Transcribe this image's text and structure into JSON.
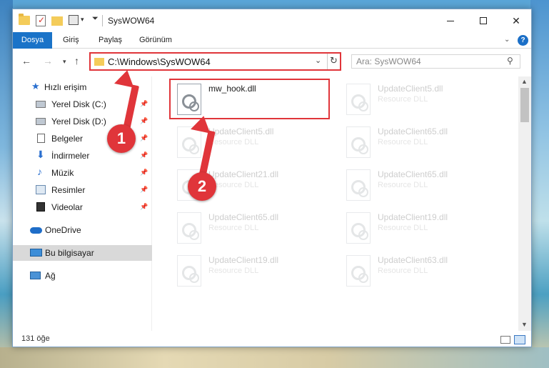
{
  "window": {
    "title": "SysWOW64",
    "minimize_label": "—",
    "close_label": "✕"
  },
  "ribbon": {
    "tabs": [
      "Dosya",
      "Giriş",
      "Paylaş",
      "Görünüm"
    ],
    "help_label": "?"
  },
  "address_bar": {
    "path": "C:\\Windows\\SysWOW64",
    "search_placeholder": "Ara: SysWOW64"
  },
  "nav_pane": {
    "quick_access": "Hızlı erişim",
    "pinned": [
      {
        "label": "Yerel Disk (C:)"
      },
      {
        "label": "Yerel Disk (D:)"
      },
      {
        "label": "Belgeler"
      },
      {
        "label": "İndirmeler"
      },
      {
        "label": "Müzik"
      },
      {
        "label": "Resimler"
      },
      {
        "label": "Videolar"
      }
    ],
    "onedrive": "OneDrive",
    "this_pc": "Bu bilgisayar",
    "network": "Ağ"
  },
  "files": [
    {
      "name": "mw_hook.dll",
      "desc": "",
      "highlighted": true
    },
    {
      "name": "UpdateClient5.dll",
      "desc": "Resource DLL"
    },
    {
      "name": "UpdateClient5.dll",
      "desc": "Resource DLL"
    },
    {
      "name": "UpdateClient65.dll",
      "desc": "Resource DLL"
    },
    {
      "name": "UpdateClient21.dll",
      "desc": "Resource DLL"
    },
    {
      "name": "UpdateClient65.dll",
      "desc": "Resource DLL"
    },
    {
      "name": "UpdateClient65.dll",
      "desc": "Resource DLL"
    },
    {
      "name": "UpdateClient19.dll",
      "desc": "Resource DLL"
    },
    {
      "name": "UpdateClient19.dll",
      "desc": "Resource DLL"
    },
    {
      "name": "UpdateClient63.dll",
      "desc": "Resource DLL"
    }
  ],
  "status": {
    "item_count": "131 öğe"
  },
  "annotations": {
    "step1": "1",
    "step2": "2",
    "color": "#e0353a"
  }
}
